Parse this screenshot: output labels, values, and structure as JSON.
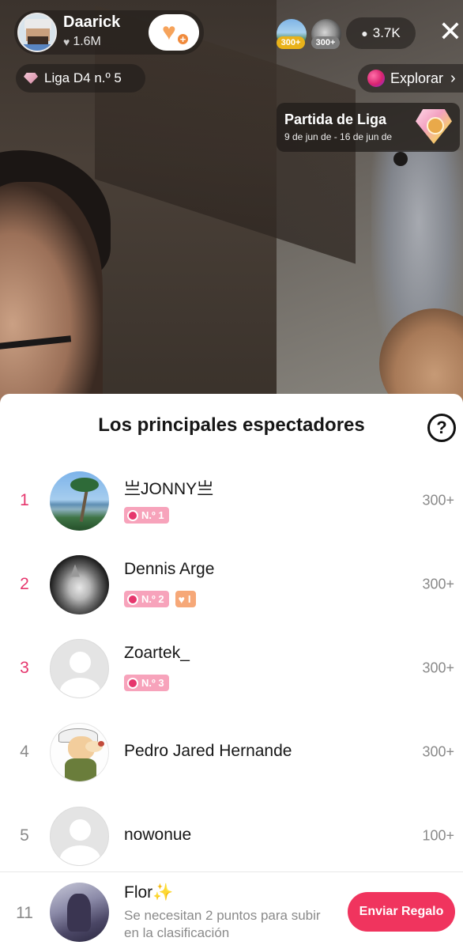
{
  "host": {
    "name": "Daarick",
    "likes": "1.6M"
  },
  "top_viewers_mini": [
    {
      "badge": "300+"
    },
    {
      "badge": "300+"
    }
  ],
  "viewer_count": "3.7K",
  "league": {
    "label": "Liga D4 n.º 5"
  },
  "explore": {
    "label": "Explorar"
  },
  "match": {
    "title": "Partida de Liga",
    "dates": "9 de jun de - 16 de jun de"
  },
  "sheet": {
    "title": "Los principales espectadores",
    "help": "?"
  },
  "rows": [
    {
      "rank": "1",
      "name": "亗JONNY亗",
      "score": "300+",
      "badges": [
        {
          "type": "rank",
          "text": "N.º 1"
        }
      ]
    },
    {
      "rank": "2",
      "name": "Dennis Arge",
      "score": "300+",
      "badges": [
        {
          "type": "rank",
          "text": "N.º 2"
        },
        {
          "type": "fan",
          "text": "I"
        }
      ]
    },
    {
      "rank": "3",
      "name": "Zoartek_",
      "score": "300+",
      "badges": [
        {
          "type": "rank",
          "text": "N.º 3"
        }
      ]
    },
    {
      "rank": "4",
      "name": "Pedro Jared Hernande",
      "score": "300+",
      "badges": []
    },
    {
      "rank": "5",
      "name": "nowonue",
      "score": "100+",
      "badges": []
    }
  ],
  "me": {
    "rank": "11",
    "name": "Flor✨",
    "hint": "Se necesitan 2 puntos para subir en la clasificación",
    "button": "Enviar Regalo"
  },
  "colors": {
    "accent": "#f0345e",
    "rank_top": "#e6366d",
    "rank_badge": "#f7a3bb",
    "fan_badge": "#f6a878"
  }
}
